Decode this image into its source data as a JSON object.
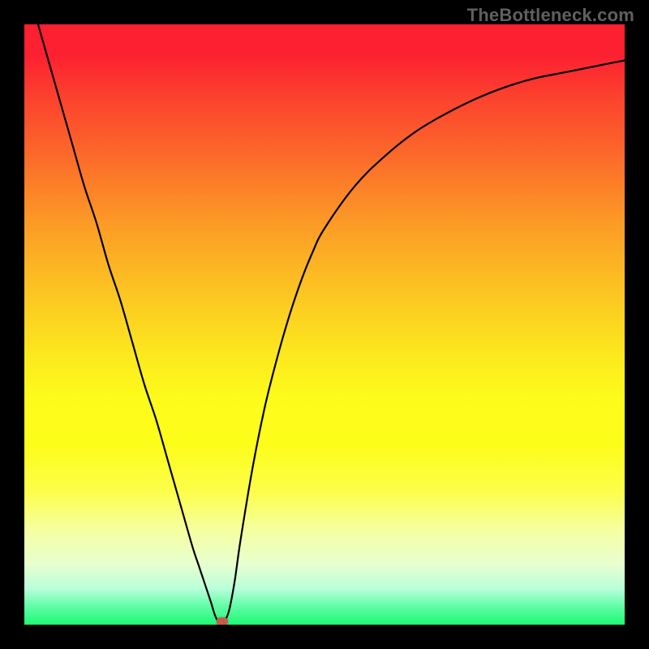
{
  "watermark": "TheBottleneck.com",
  "colors": {
    "frame_border": "#000000",
    "curve_stroke": "#000000",
    "marker_fill": "#C95B4A",
    "gradient_top": "#FC2031",
    "gradient_bottom": "#1EF974"
  },
  "chart_data": {
    "type": "line",
    "title": "",
    "xlabel": "",
    "ylabel": "",
    "xlim": [
      0,
      100
    ],
    "ylim": [
      0,
      100
    ],
    "grid": false,
    "series": [
      {
        "name": "bottleneck_curve",
        "x": [
          0,
          2,
          4,
          6,
          8,
          10,
          12,
          14,
          16,
          18,
          20,
          22,
          24,
          26,
          28,
          29,
          30,
          31,
          32,
          33,
          34,
          35,
          36,
          38,
          40,
          42,
          44,
          46,
          48,
          50,
          55,
          60,
          65,
          70,
          75,
          80,
          85,
          90,
          95,
          100
        ],
        "y": [
          108,
          101,
          94,
          87,
          80,
          73,
          67,
          60,
          54,
          47,
          40,
          34,
          27,
          20,
          13,
          10,
          7,
          4,
          1,
          0.5,
          2,
          7,
          14,
          26,
          36,
          44,
          51,
          57,
          62,
          66,
          73,
          78,
          82,
          85,
          87.5,
          89.5,
          91,
          92,
          93,
          94
        ]
      }
    ],
    "marker": {
      "x": 33,
      "y": 0.5
    },
    "description": "V-shaped curve over vertical red-to-green gradient. Minimum (optimum) near x≈33. Left branch descends steeply and nearly linearly from upper-left corner; right branch rises with diminishing slope toward upper-right, asymptoting near y≈94."
  }
}
